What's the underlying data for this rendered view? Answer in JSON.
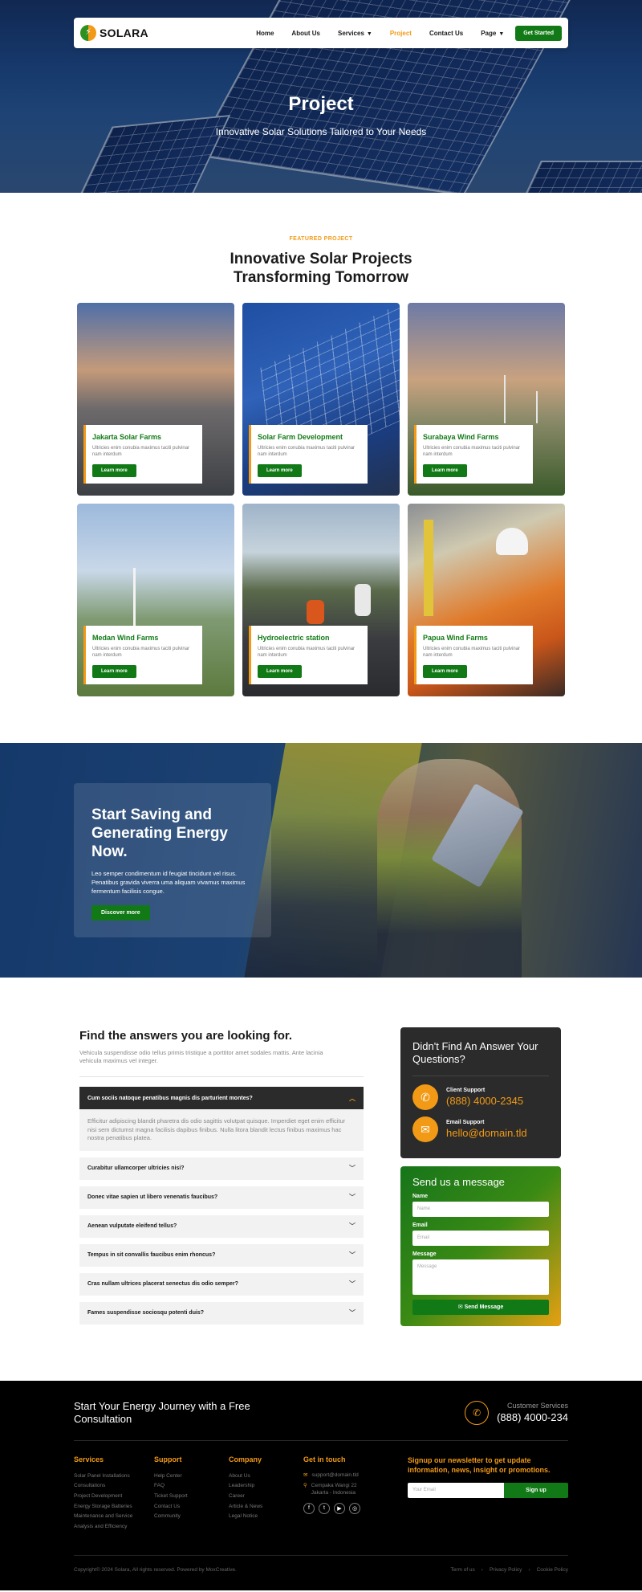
{
  "nav": {
    "brand": "SOLARA",
    "links": [
      "Home",
      "About Us",
      "Services",
      "Project",
      "Contact Us",
      "Page"
    ],
    "cta": "Get Started",
    "active": "Project"
  },
  "hero": {
    "title": "Project",
    "subtitle": "Innovative Solar Solutions Tailored to Your Needs"
  },
  "projects": {
    "eyebrow": "FEATURED PROJECT",
    "title": "Innovative Solar Projects Transforming Tomorrow",
    "cards": [
      {
        "title": "Jakarta Solar Farms",
        "text": "Ultricies enim conubia maximus taciti pulvinar nam interdum",
        "button": "Learn more"
      },
      {
        "title": "Solar Farm Development",
        "text": "Ultricies enim conubia maximus taciti pulvinar nam interdum",
        "button": "Learn more"
      },
      {
        "title": "Surabaya Wind Farms",
        "text": "Ultricies enim conubia maximus taciti pulvinar nam interdum",
        "button": "Learn more"
      },
      {
        "title": "Medan Wind Farms",
        "text": "Ultricies enim conubia maximus taciti pulvinar nam interdum",
        "button": "Learn more"
      },
      {
        "title": "Hydroelectric station",
        "text": "Ultricies enim conubia maximus taciti pulvinar nam interdum",
        "button": "Learn more"
      },
      {
        "title": "Papua Wind Farms",
        "text": "Ultricies enim conubia maximus taciti pulvinar nam interdum",
        "button": "Learn more"
      }
    ]
  },
  "cta": {
    "title": "Start Saving and Generating Energy Now.",
    "text": "Leo semper condimentum id feugiat tincidunt vel risus. Penatibus gravida viverra uma aliquam vivamus maximus fermentum facilisis congue.",
    "button": "Discover more"
  },
  "faq": {
    "title": "Find the answers you are looking for.",
    "description": "Vehicula suspendisse odio tellus primis tristique a porttitor amet sodales mattis. Ante lacinia vehicula maximus vel integer.",
    "open_question": "Cum sociis natoque penatibus magnis dis parturient montes?",
    "open_answer": "Efficitur adipiscing blandit pharetra dis odio sagittis volutpat quisque. Imperdiet eget enim efficitur nisi sem dictumst magna facilisis dapibus finibus. Nulla litora blandit lectus finibus maximus hac nostra penatibus platea.",
    "questions": [
      "Curabitur ullamcorper ultricies nisi?",
      "Donec vitae sapien ut libero venenatis faucibus?",
      "Aenean vulputate eleifend tellus?",
      "Tempus in sit convallis faucibus enim rhoncus?",
      "Cras nullam ultrices placerat senectus dis odio semper?",
      "Fames suspendisse sociosqu potenti duis?"
    ]
  },
  "support": {
    "title": "Didn't Find An Answer Your Questions?",
    "client_label": "Client Support",
    "client_phone": "(888) 4000-2345",
    "email_label": "Email Support",
    "email": "hello@domain.tld"
  },
  "message": {
    "title": "Send us a message",
    "name_label": "Name",
    "name_placeholder": "Name",
    "email_label": "Email",
    "email_placeholder": "Email",
    "message_label": "Message",
    "message_placeholder": "Message",
    "button": "Send Message"
  },
  "footer": {
    "headline": "Start Your Energy Journey with a Free Consultation",
    "cs_label": "Customer Services",
    "cs_phone": "(888) 4000-234",
    "services_title": "Services",
    "services": [
      "Solar Panel Installations",
      "Consultations",
      "Project Development",
      "Energy Storage Batteries",
      "Maintenance and Service",
      "Analysis and Efficiency"
    ],
    "support_title": "Support",
    "support": [
      "Help Center",
      "FAQ",
      "Ticket Support",
      "Contact Us",
      "Community"
    ],
    "company_title": "Company",
    "company": [
      "About Us",
      "Leadership",
      "Career",
      "Article & News",
      "Legal Notice"
    ],
    "contact_title": "Get in touch",
    "contact_email": "support@domain.tld",
    "contact_address": "Cempaka Wangi 22 Jakarta - Indonesia",
    "newsletter_title": "Signup our newsletter to get update information, news, insight or promotions.",
    "newsletter_placeholder": "Your Email",
    "newsletter_button": "Sign up",
    "copyright": "Copyright© 2024 Solara, All rights reserved. Powered by MoxCreative.",
    "legal_links": [
      "Term of us",
      "Privacy Policy",
      "Cookie Policy"
    ]
  },
  "colors": {
    "accent": "#f29a16",
    "primary": "#117a16",
    "dark": "#2b2b2b"
  }
}
